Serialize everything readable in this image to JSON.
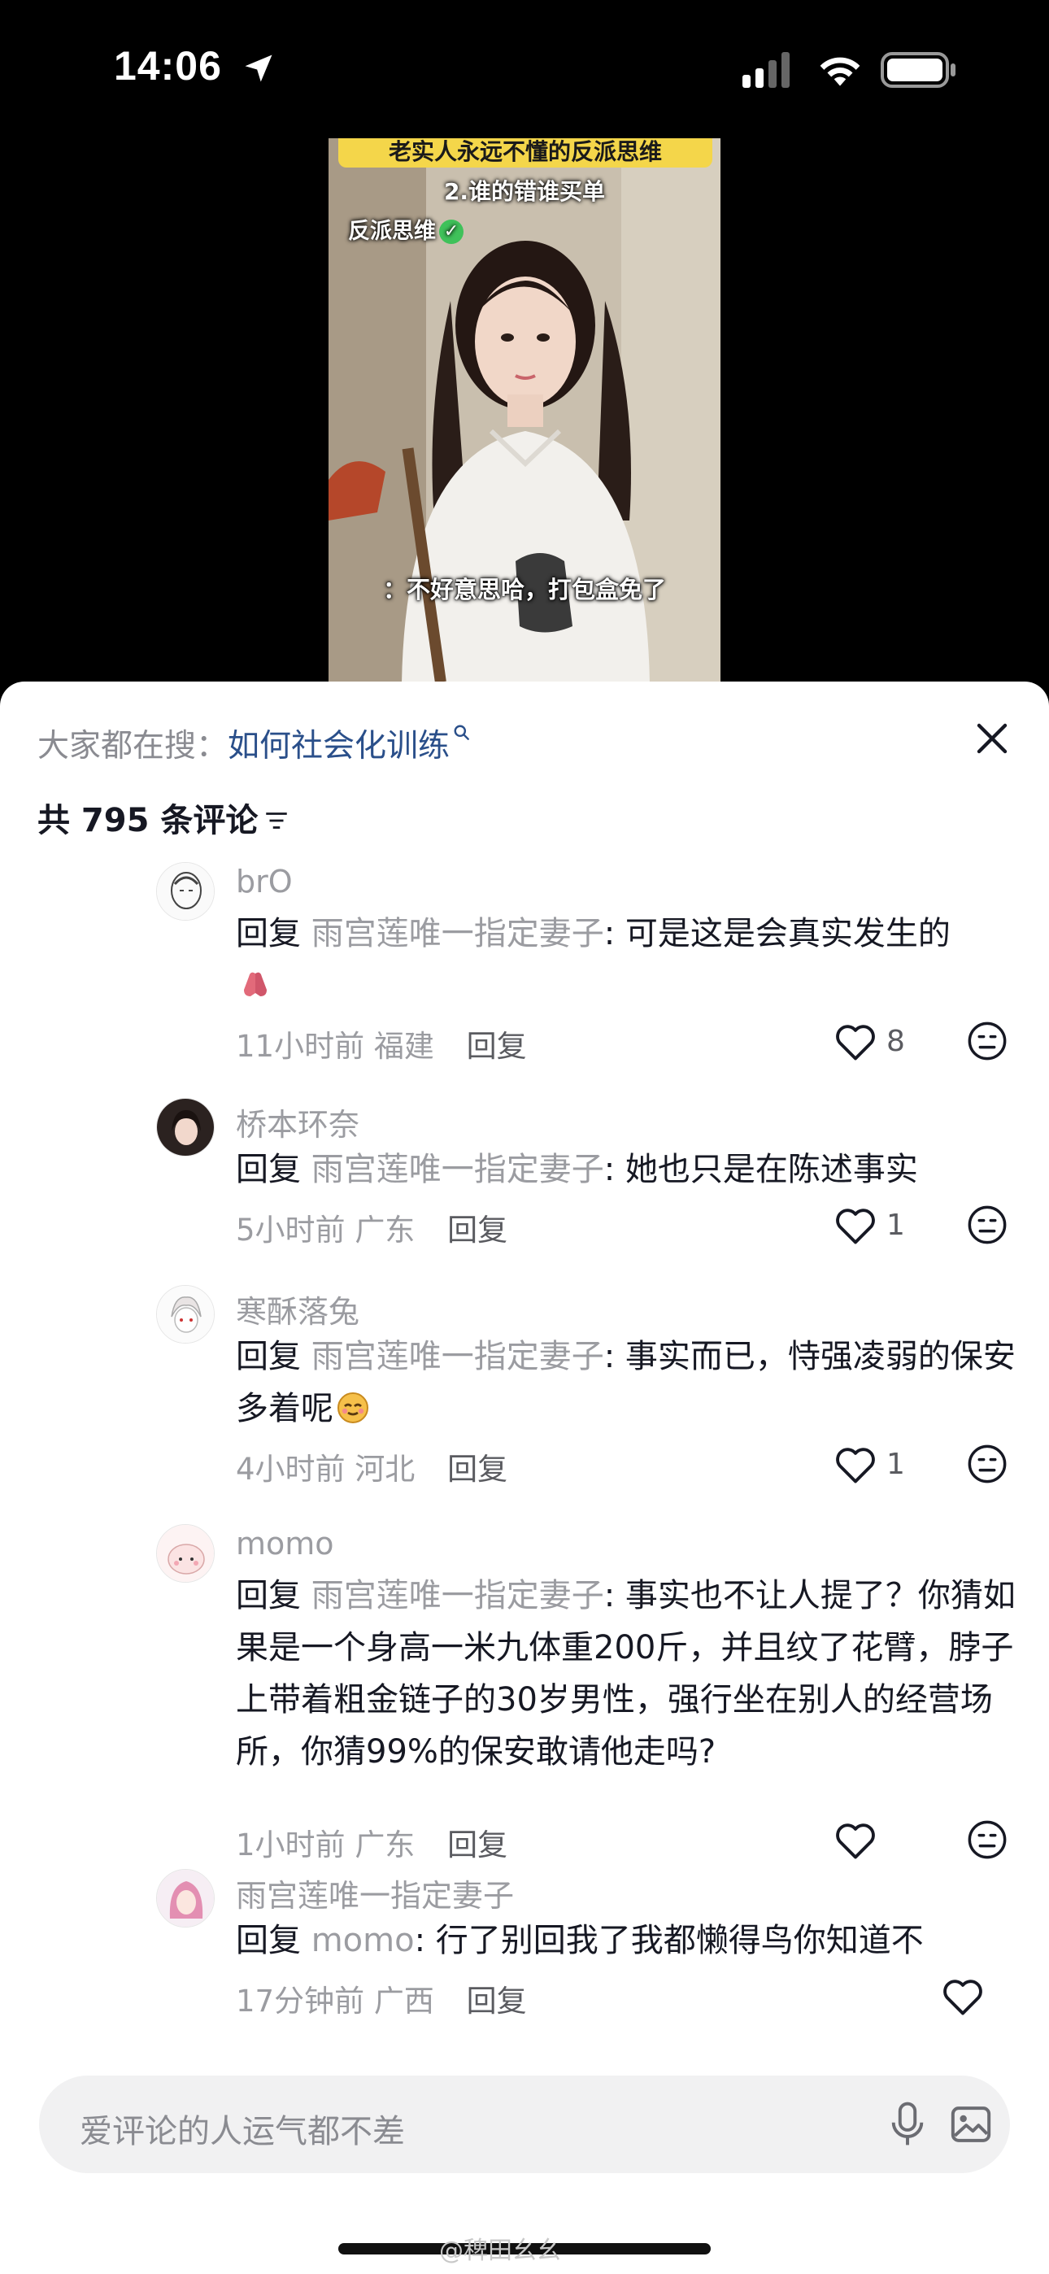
{
  "status_bar": {
    "time": "14:06"
  },
  "video": {
    "banner": "老实人永远不懂的反派思维",
    "subtitle": "2.谁的错谁买单",
    "tag": "反派思维",
    "caption": "：不好意思哈，打包盒免了"
  },
  "search_bar": {
    "prefix": "大家都在搜：",
    "query": "如何社会化训练"
  },
  "comment_count_label": "共 795 条评论",
  "comments": [
    {
      "name": "brO",
      "reply_word": "回复",
      "target": "雨宫莲唯一指定妻子",
      "text": ": 可是这是会真实发生的",
      "time": "11小时前",
      "location": "福建",
      "reply": "回复",
      "likes": "8"
    },
    {
      "name": "桥本环奈",
      "reply_word": "回复",
      "target": "雨宫莲唯一指定妻子",
      "text": ": 她也只是在陈述事实",
      "time": "5小时前",
      "location": "广东",
      "reply": "回复",
      "likes": "1"
    },
    {
      "name": "寒酥落兔",
      "reply_word": "回复",
      "target": "雨宫莲唯一指定妻子",
      "text": ": 事实而已，恃强凌弱的保安多着呢",
      "time": "4小时前",
      "location": "河北",
      "reply": "回复",
      "likes": "1"
    },
    {
      "name": "momo",
      "reply_word": "回复",
      "target": "雨宫莲唯一指定妻子",
      "text": ": 事实也不让人提了？你猜如果是一个身高一米九体重200斤，并且纹了花臂，脖子上带着粗金链子的30岁男性，强行坐在别人的经营场所，你猜99%的保安敢请他走吗?",
      "time": "1小时前",
      "location": "广东",
      "reply": "回复",
      "likes": ""
    },
    {
      "name": "雨宫莲唯一指定妻子",
      "reply_word": "回复",
      "target": "momo",
      "text": ": 行了别回我了我都懒得鸟你知道不",
      "time": "17分钟前",
      "location": "广西",
      "reply": "回复",
      "likes": ""
    }
  ],
  "input": {
    "placeholder": "爱评论的人运气都不差"
  },
  "watermark": "@稗田幺幺",
  "colors": {
    "link_blue": "#2a4f8a",
    "muted_gray": "#9b9ca1",
    "text_dark": "#161823",
    "input_bg": "#f1f1f2"
  }
}
